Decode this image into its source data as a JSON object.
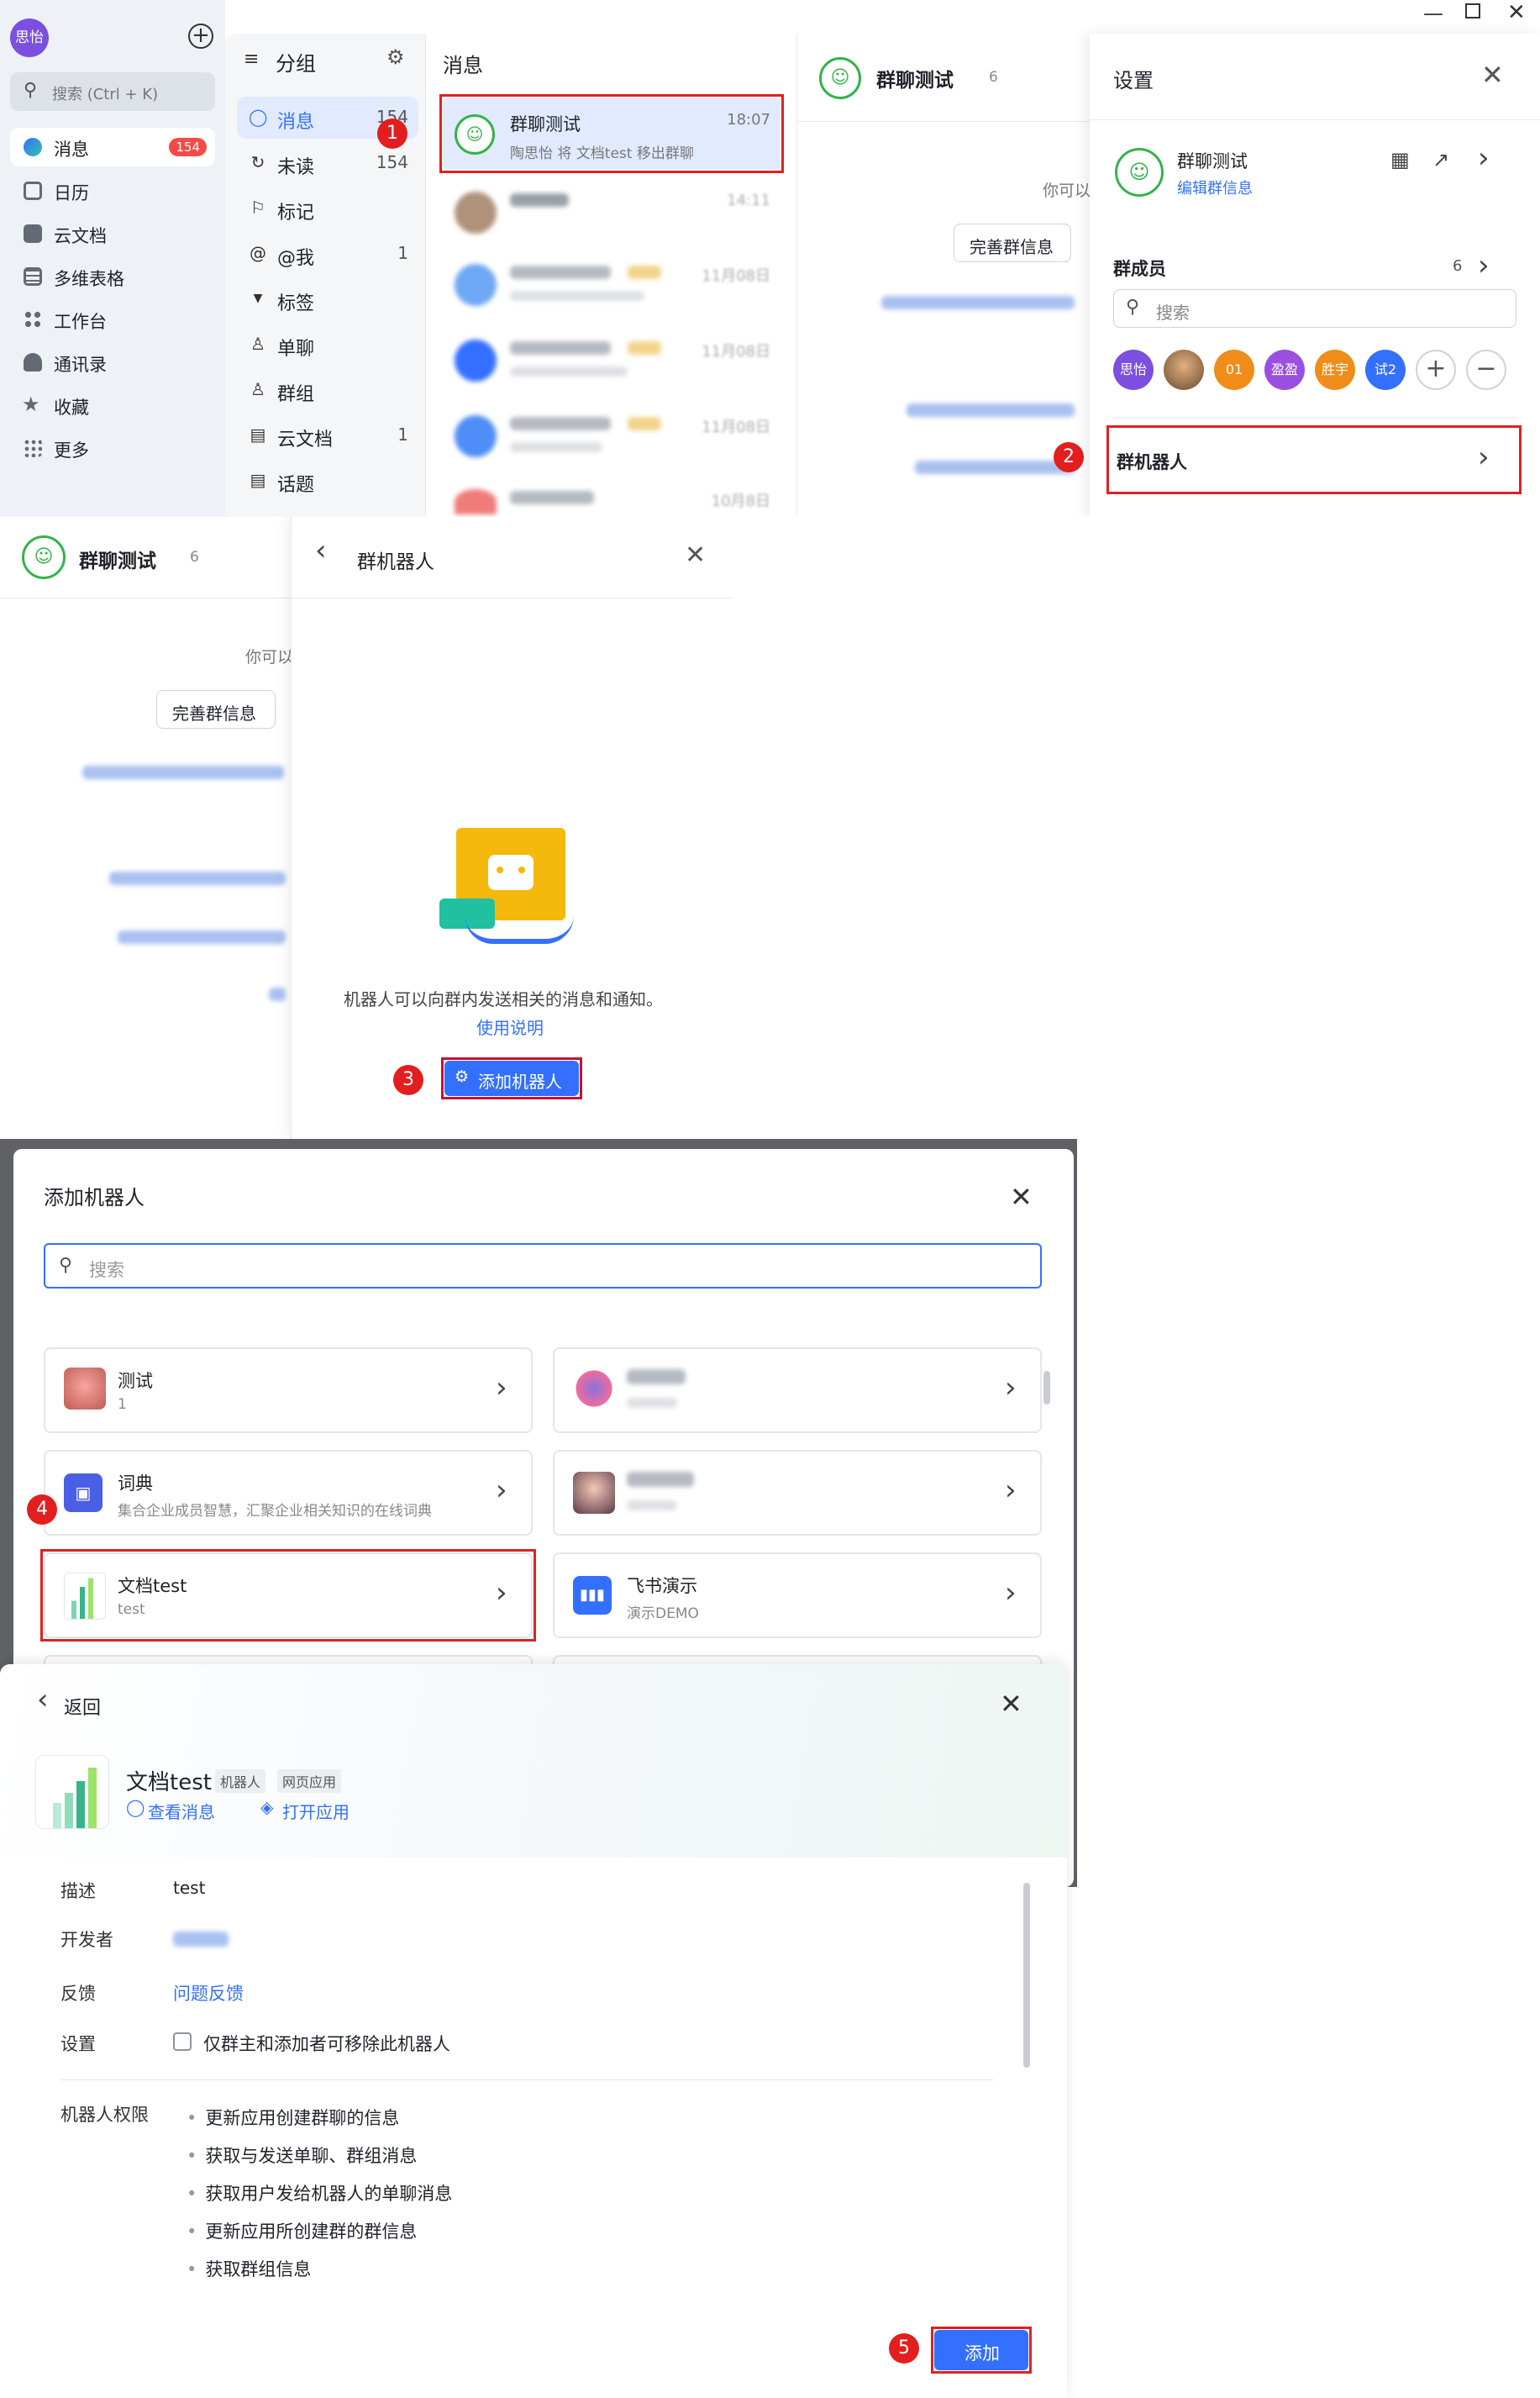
{
  "colors": {
    "accent": "#3370ff",
    "highlight": "#e02020",
    "green": "#34b34a"
  },
  "steps": [
    "1",
    "2",
    "3",
    "4",
    "5"
  ],
  "sidebar": {
    "user_avatar": "思怡",
    "search_placeholder": "搜索 (Ctrl + K)",
    "items": [
      {
        "label": "消息",
        "badge": "154",
        "icon": "chat-bubble-icon"
      },
      {
        "label": "日历",
        "icon": "calendar-icon"
      },
      {
        "label": "云文档",
        "icon": "doc-icon"
      },
      {
        "label": "多维表格",
        "icon": "table-icon"
      },
      {
        "label": "工作台",
        "icon": "grid-icon"
      },
      {
        "label": "通讯录",
        "icon": "contacts-icon"
      },
      {
        "label": "收藏",
        "icon": "star-icon"
      },
      {
        "label": "更多",
        "icon": "more-icon"
      }
    ]
  },
  "groups": {
    "title": "分组",
    "items": [
      {
        "label": "消息",
        "count": "154"
      },
      {
        "label": "未读",
        "count": "154"
      },
      {
        "label": "标记",
        "count": ""
      },
      {
        "label": "@我",
        "count": "1"
      },
      {
        "label": "标签",
        "count": ""
      },
      {
        "label": "单聊",
        "count": ""
      },
      {
        "label": "群组",
        "count": ""
      },
      {
        "label": "云文档",
        "count": "1"
      },
      {
        "label": "话题",
        "count": ""
      }
    ]
  },
  "messages": {
    "title": "消息",
    "selected": {
      "name": "群聊测试",
      "time": "18:07",
      "preview": "陶思怡 将 文档test 移出群聊"
    },
    "others": [
      {
        "time": "14:11"
      },
      {
        "time": "11月08日"
      },
      {
        "time": "11月08日"
      },
      {
        "time": "11月08日"
      },
      {
        "time": "10月8日"
      }
    ]
  },
  "chat": {
    "name": "群聊测试",
    "member_count": "6",
    "hint": "你可以",
    "complete_info_button": "完善群信息"
  },
  "settings": {
    "title": "设置",
    "group_name": "群聊测试",
    "edit_link": "编辑群信息",
    "members_label": "群成员",
    "members_count": "6",
    "search_placeholder": "搜索",
    "members": [
      "思怡",
      "",
      "01",
      "盈盈",
      "胜宇",
      "试2"
    ],
    "robots_label": "群机器人"
  },
  "robot_panel": {
    "title": "群机器人",
    "description": "机器人可以向群内发送相关的消息和通知。",
    "usage_link": "使用说明",
    "add_button": "添加机器人"
  },
  "add_dialog": {
    "title": "添加机器人",
    "search_placeholder": "搜索",
    "bots": [
      {
        "name": "测试",
        "sub": "1"
      },
      {
        "name": "",
        "sub": ""
      },
      {
        "name": "词典",
        "sub": "集合企业成员智慧，汇聚企业相关知识的在线词典"
      },
      {
        "name": "",
        "sub": ""
      },
      {
        "name": "文档test",
        "sub": "test"
      },
      {
        "name": "飞书演示",
        "sub": "演示DEMO"
      }
    ]
  },
  "detail": {
    "back": "返回",
    "name": "文档test",
    "tags": [
      "机器人",
      "网页应用"
    ],
    "view_messages": "查看消息",
    "open_app": "打开应用",
    "desc_label": "描述",
    "desc_value": "test",
    "dev_label": "开发者",
    "feedback_label": "反馈",
    "feedback_link": "问题反馈",
    "setting_label": "设置",
    "setting_option": "仅群主和添加者可移除此机器人",
    "perm_label": "机器人权限",
    "permissions": [
      "更新应用创建群聊的信息",
      "获取与发送单聊、群组消息",
      "获取用户发给机器人的单聊消息",
      "更新应用所创建群的群信息",
      "获取群组信息"
    ],
    "add_button": "添加"
  }
}
